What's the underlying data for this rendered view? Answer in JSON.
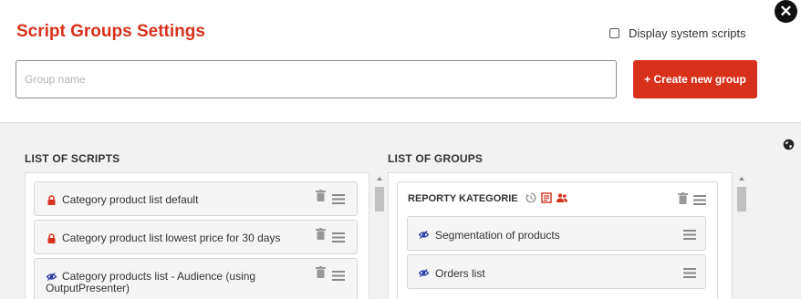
{
  "header": {
    "title": "Script Groups Settings",
    "close_icon": "close-icon",
    "display_system_scripts_label": "Display system scripts",
    "group_name_placeholder": "Group name",
    "create_button_label": "+ Create new group"
  },
  "scripts": {
    "heading": "LIST OF SCRIPTS",
    "items": [
      {
        "label": "Category product list default",
        "icon": "lock-icon"
      },
      {
        "label": "Category product list lowest price for 30 days",
        "icon": "lock-icon"
      },
      {
        "label": "Category products list - Audience (using OutputPresenter)",
        "icon": "eye-icon"
      }
    ]
  },
  "groups": {
    "heading": "LIST OF GROUPS",
    "cards": [
      {
        "title": "REPORTY KATEGORIE",
        "icons": [
          "history-icon",
          "report-icon",
          "users-icon"
        ],
        "items": [
          {
            "label": "Segmentation of products",
            "icon": "eye-icon"
          },
          {
            "label": "Orders list",
            "icon": "eye-icon"
          }
        ]
      }
    ]
  },
  "colors": {
    "accent": "#d8311b",
    "eye": "#2a3aa6"
  }
}
